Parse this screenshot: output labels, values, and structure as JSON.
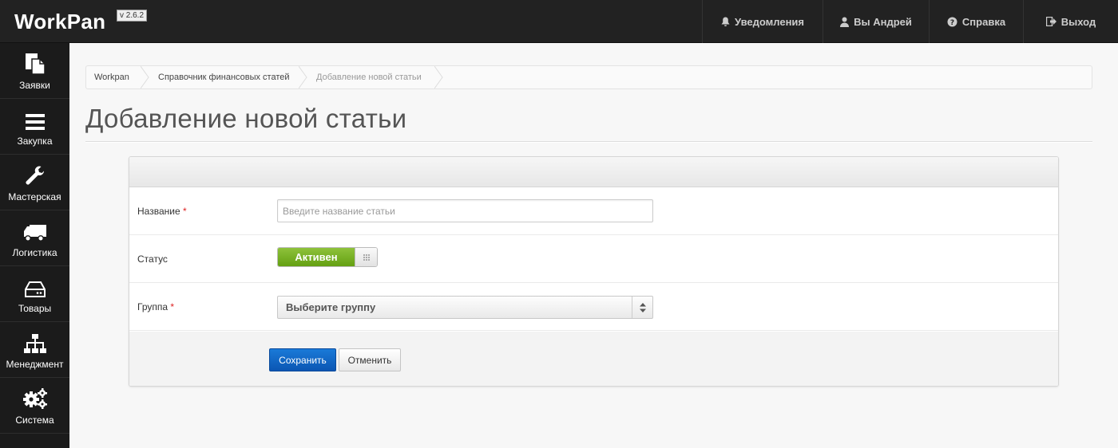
{
  "app": {
    "brand": "WorkPan",
    "version": "v 2.6.2"
  },
  "topnav": [
    {
      "label": "Уведомления",
      "icon": "bell-icon"
    },
    {
      "label": "Вы Андрей",
      "icon": "user-icon"
    },
    {
      "label": "Справка",
      "icon": "question-icon"
    },
    {
      "label": "Выход",
      "icon": "logout-icon"
    }
  ],
  "sidebar": [
    {
      "label": "Заявки",
      "icon": "documents-icon"
    },
    {
      "label": "Закупка",
      "icon": "menu-lines-icon"
    },
    {
      "label": "Мастерская",
      "icon": "wrench-icon"
    },
    {
      "label": "Логистика",
      "icon": "truck-icon"
    },
    {
      "label": "Товары",
      "icon": "drive-icon"
    },
    {
      "label": "Менеджмент",
      "icon": "sitemap-icon"
    },
    {
      "label": "Система",
      "icon": "gears-icon"
    }
  ],
  "breadcrumb": [
    {
      "label": "Workpan"
    },
    {
      "label": "Справочник финансовых статей"
    },
    {
      "label": "Добавление новой статьи"
    }
  ],
  "page": {
    "title": "Добавление новой статьи"
  },
  "form": {
    "name": {
      "label": "Название",
      "required_mark": "*",
      "placeholder": "Введите название статьи",
      "value": ""
    },
    "status": {
      "label": "Статус",
      "toggle_label": "Активен",
      "on": true
    },
    "group": {
      "label": "Группа",
      "required_mark": "*",
      "selected": "Выберите группу"
    },
    "actions": {
      "save": "Сохранить",
      "cancel": "Отменить"
    }
  },
  "colors": {
    "accent": "#0b56b3",
    "toggle_on": "#64a012",
    "required": "#dd2222",
    "topbar": "#222222"
  }
}
